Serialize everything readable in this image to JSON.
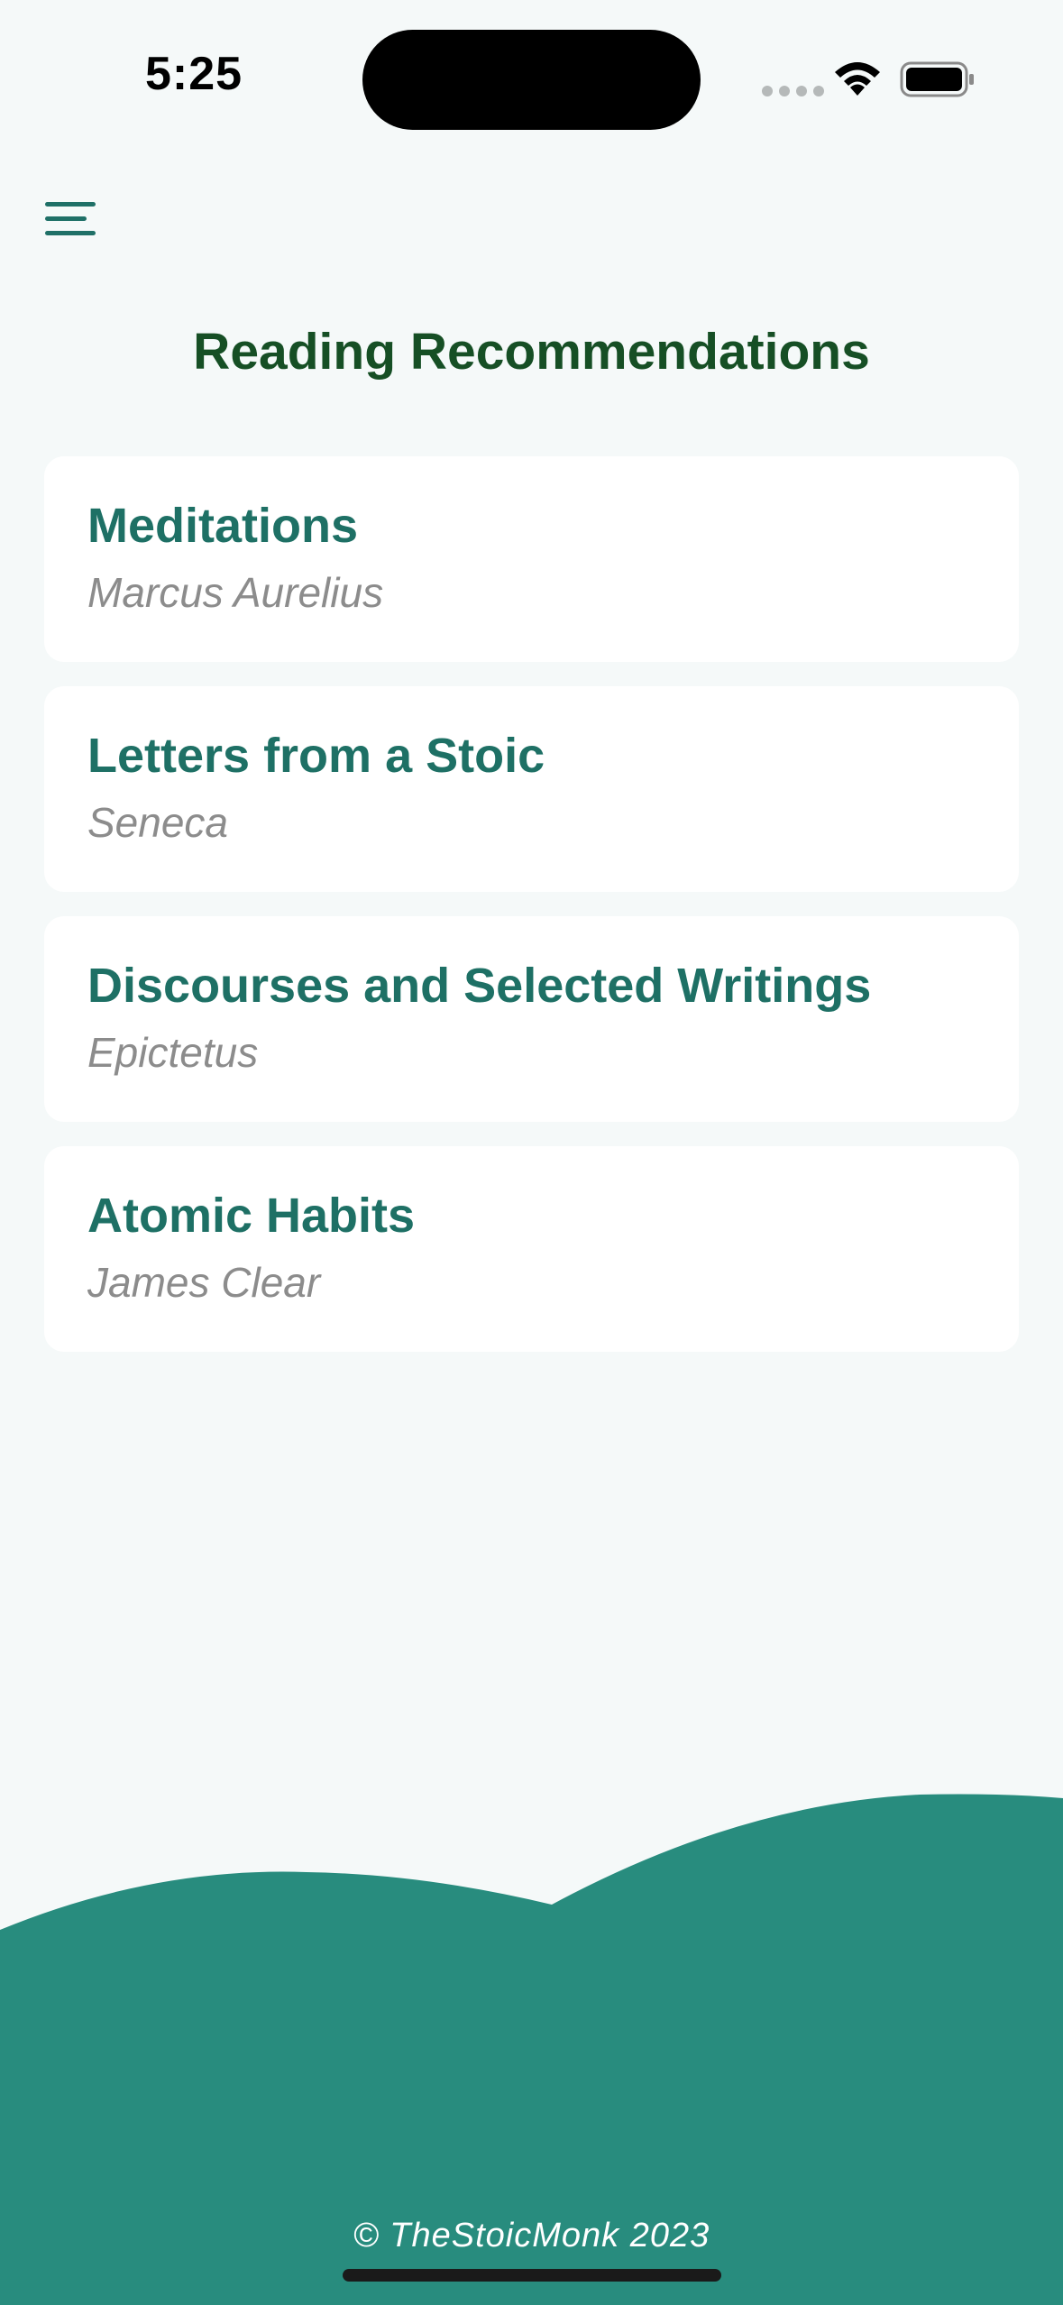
{
  "status_bar": {
    "time": "5:25"
  },
  "header": {
    "menu_icon": "hamburger-menu-icon",
    "title": "Reading Recommendations"
  },
  "books": [
    {
      "title": "Meditations",
      "author": "Marcus Aurelius"
    },
    {
      "title": "Letters from a Stoic",
      "author": "Seneca"
    },
    {
      "title": "Discourses and Selected Writings",
      "author": "Epictetus"
    },
    {
      "title": "Atomic Habits",
      "author": "James Clear"
    }
  ],
  "footer": {
    "copyright": "© TheStoicMonk 2023"
  },
  "colors": {
    "background": "#f5f9f9",
    "accent": "#288c7e",
    "title": "#164f25",
    "book_title": "#1e7065",
    "author": "#8c8c8c"
  }
}
